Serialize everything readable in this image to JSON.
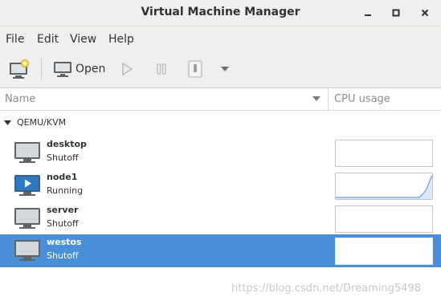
{
  "window": {
    "title": "Virtual Machine Manager",
    "controls": [
      "minimize-icon",
      "maximize-icon",
      "close-icon"
    ]
  },
  "menu": {
    "file": "File",
    "edit": "Edit",
    "view": "View",
    "help": "Help"
  },
  "toolbar": {
    "new_icon": "new-vm-icon",
    "open_label": "Open",
    "open_icon": "monitor-icon",
    "run_icon": "play-icon",
    "pause_icon": "pause-icon",
    "shutdown_icon": "power-icon",
    "dropdown_icon": "chevron-down-icon"
  },
  "table": {
    "columns": {
      "name": "Name",
      "cpu": "CPU usage"
    }
  },
  "group": {
    "label": "QEMU/KVM",
    "expanded": true
  },
  "vms": [
    {
      "name": "desktop",
      "status": "Shutoff",
      "icon": "vm-off-icon",
      "selected": false,
      "cpu_usage": []
    },
    {
      "name": "node1",
      "status": "Running",
      "icon": "vm-running-icon",
      "selected": false,
      "cpu_usage": [
        0,
        0,
        0,
        0,
        0,
        0,
        0,
        0,
        0,
        0,
        0,
        0,
        0,
        0,
        0.3,
        1.0
      ]
    },
    {
      "name": "server",
      "status": "Shutoff",
      "icon": "vm-off-icon",
      "selected": false,
      "cpu_usage": []
    },
    {
      "name": "westos",
      "status": "Shutoff",
      "icon": "vm-off-icon",
      "selected": true,
      "cpu_usage": []
    }
  ],
  "colors": {
    "selection": "#4a90d9",
    "chrome": "#f0efee",
    "graph_line": "#6e9fd6"
  },
  "watermark": "https://blog.csdn.net/Dreaming5498"
}
